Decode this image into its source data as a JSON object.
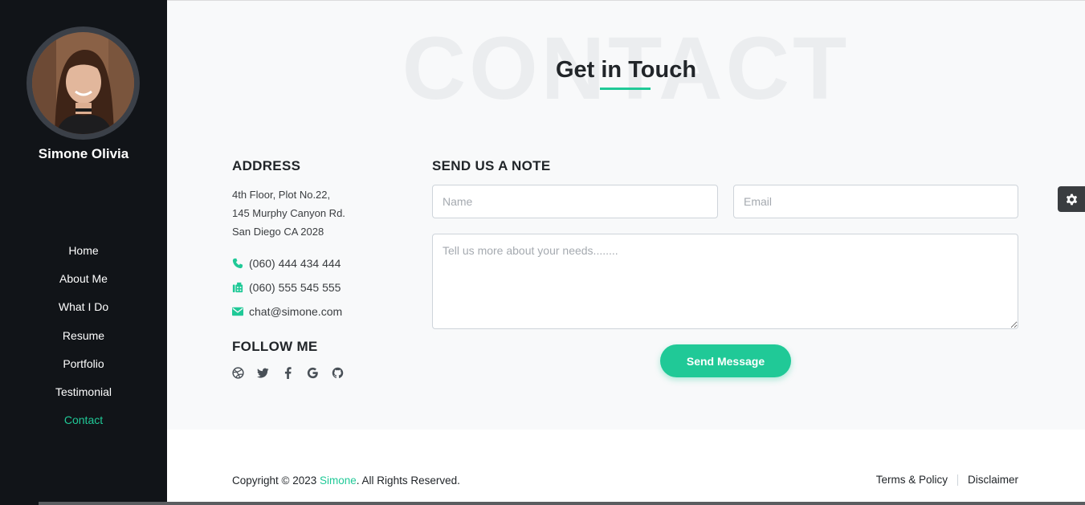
{
  "sidebar": {
    "profile_name": "Simone Olivia",
    "nav": [
      {
        "label": "Home"
      },
      {
        "label": "About Me"
      },
      {
        "label": "What I Do"
      },
      {
        "label": "Resume"
      },
      {
        "label": "Portfolio"
      },
      {
        "label": "Testimonial"
      },
      {
        "label": "Contact",
        "active": true
      }
    ]
  },
  "section": {
    "background_word": "CONTACT",
    "heading": "Get in Touch"
  },
  "address": {
    "title": "ADDRESS",
    "lines": [
      "4th Floor, Plot No.22,",
      "145 Murphy Canyon Rd.",
      "San Diego CA 2028"
    ],
    "phone": "(060) 444 434 444",
    "fax": "(060) 555 545 555",
    "email": "chat@simone.com"
  },
  "follow": {
    "title": "FOLLOW ME",
    "icons": [
      "dribbble-icon",
      "twitter-icon",
      "facebook-icon",
      "google-icon",
      "github-icon"
    ]
  },
  "form": {
    "title": "SEND US A NOTE",
    "name_placeholder": "Name",
    "email_placeholder": "Email",
    "message_placeholder": "Tell us more about your needs........",
    "submit_label": "Send Message"
  },
  "footer": {
    "copyright_prefix": "Copyright © 2023 ",
    "brand": "Simone",
    "copyright_suffix": ". All Rights Reserved.",
    "terms": "Terms & Policy",
    "disclaimer": "Disclaimer"
  },
  "colors": {
    "accent": "#20c997",
    "sidebar_bg": "#111418",
    "page_bg": "#f8f9fa"
  }
}
